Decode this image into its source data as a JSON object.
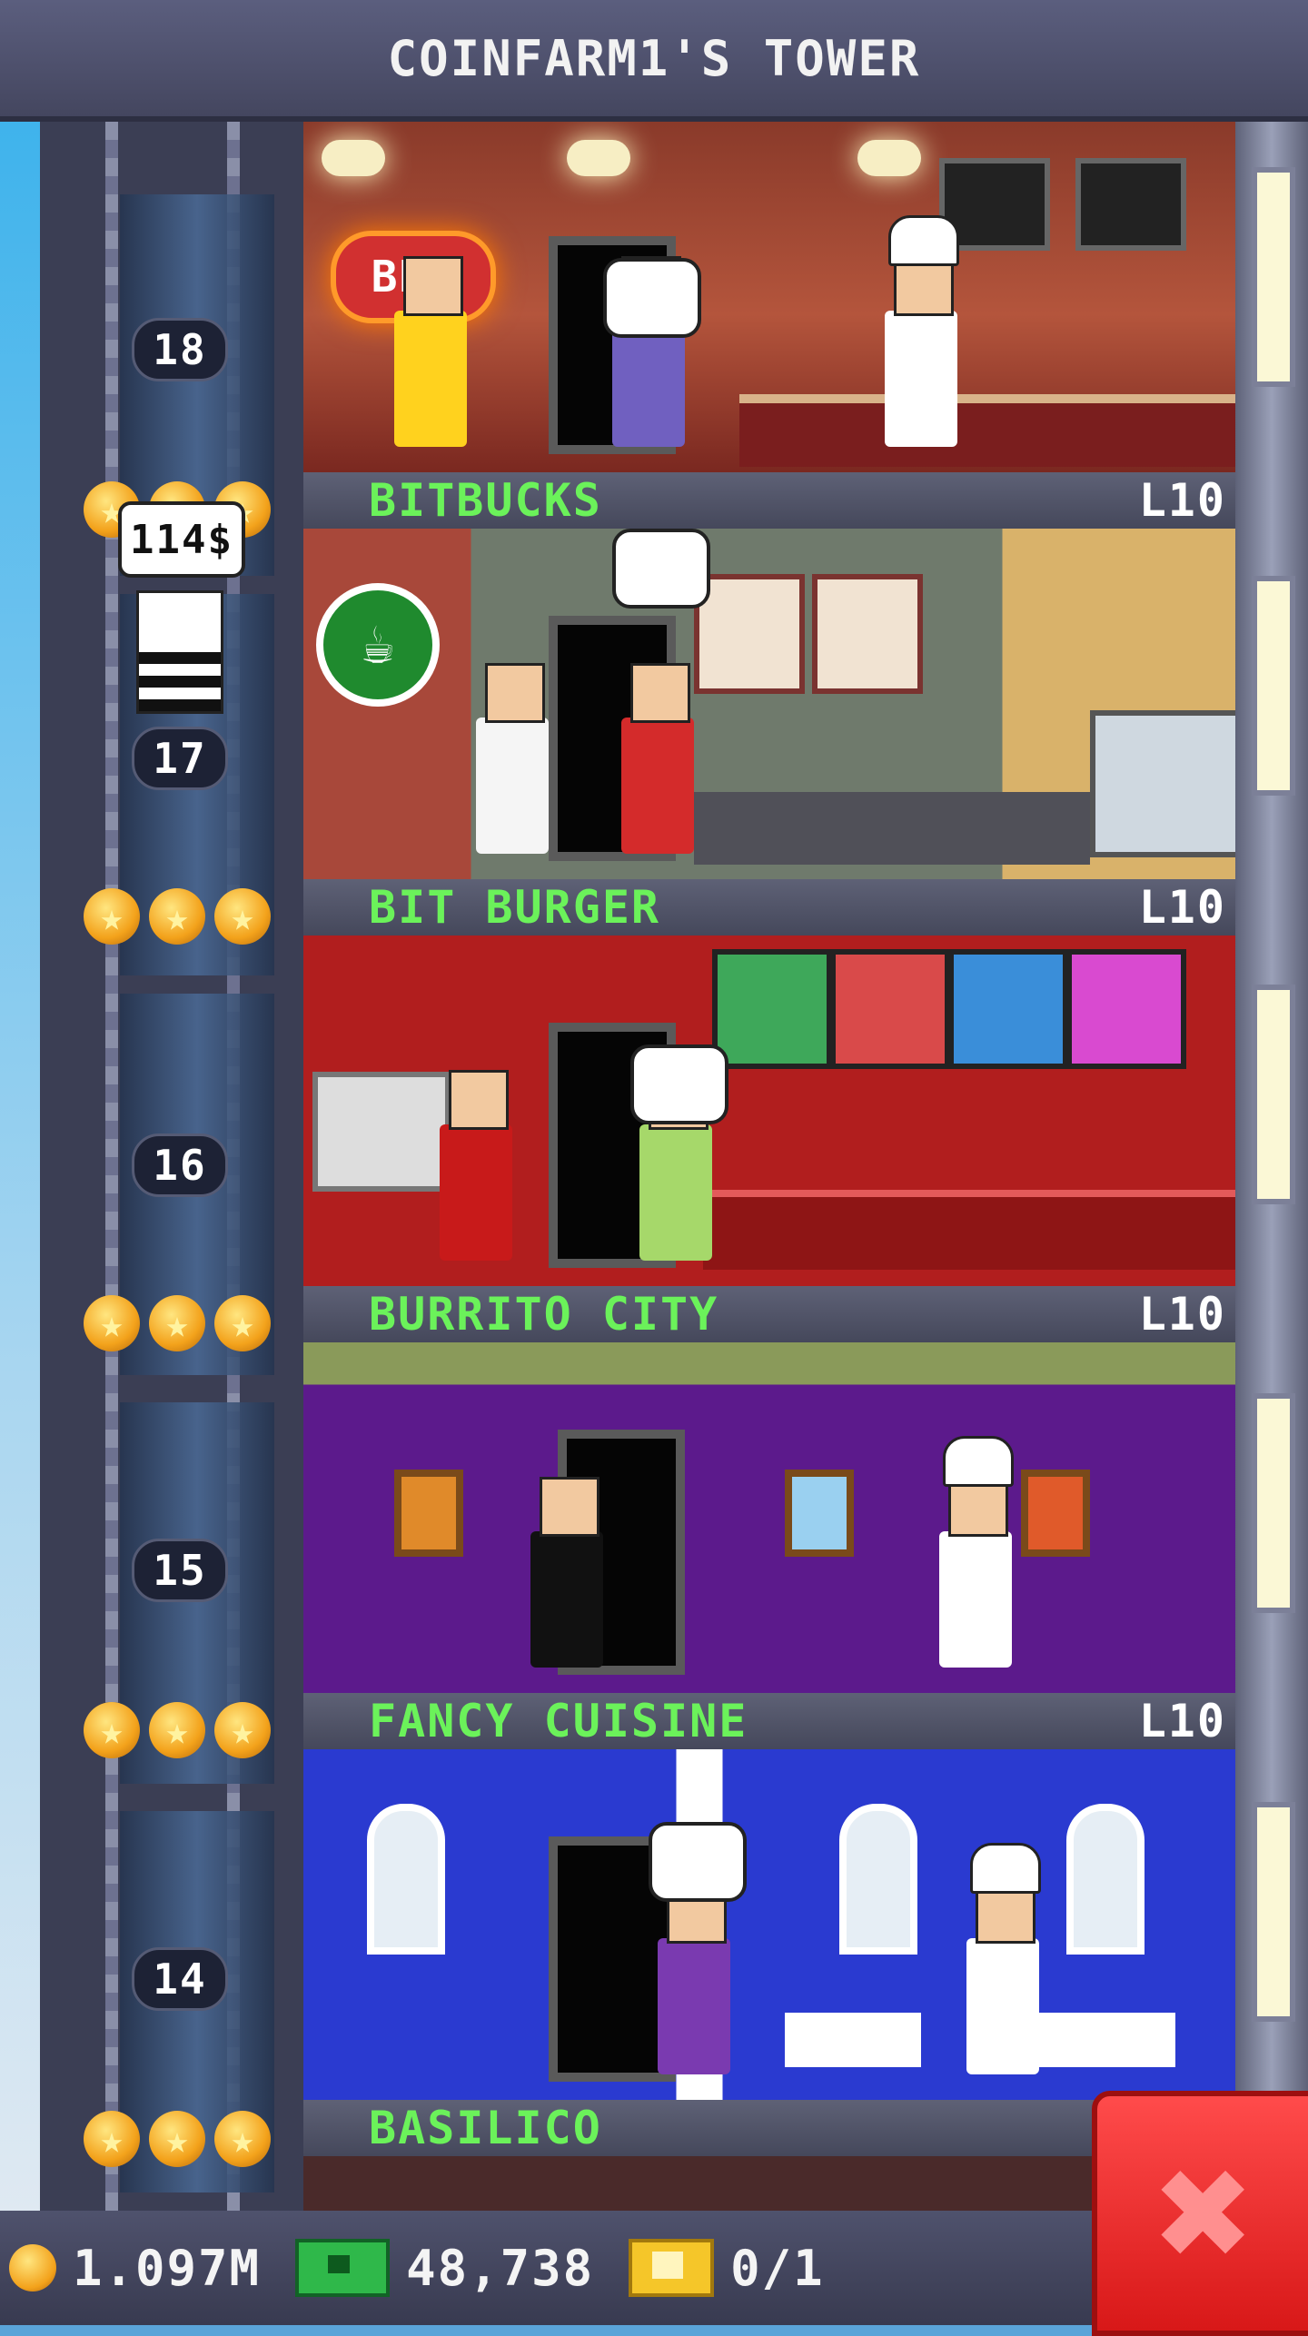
{
  "header": {
    "title": "COINFARM1'S TOWER"
  },
  "elevator": {
    "passenger_bubble": "114$",
    "floor_numbers": [
      "18",
      "17",
      "16",
      "15",
      "14"
    ]
  },
  "floors": [
    {
      "name": "BITBUCKS",
      "level": "L10",
      "sign_text": ""
    },
    {
      "name": "BIT BURGER",
      "level": "L10"
    },
    {
      "name": "BURRITO CITY",
      "level": "L10"
    },
    {
      "name": "FANCY CUISINE",
      "level": "L10"
    },
    {
      "name": "BASILICO",
      "level": ""
    }
  ],
  "top_floor": {
    "sign_text": "BBQ"
  },
  "bottom_bar": {
    "coins": "1.097M",
    "bux": "48,738",
    "tickets": "0/1"
  },
  "colors": {
    "label_green": "#6bf25a",
    "close_red": "#e52525"
  },
  "icons": [
    "coin-icon",
    "bux-icon",
    "golden-ticket-icon",
    "close-icon",
    "star-icon"
  ]
}
